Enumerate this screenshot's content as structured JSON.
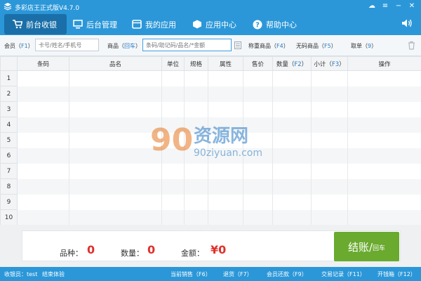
{
  "window": {
    "title": "多彩店王正式版V4.7.0",
    "controls": [
      "cloud-icon",
      "menu-icon",
      "minimize-icon",
      "close-icon"
    ]
  },
  "nav": {
    "tabs": [
      {
        "label": "前台收银",
        "icon": "cart-icon",
        "active": true
      },
      {
        "label": "后台管理",
        "icon": "monitor-icon",
        "active": false
      },
      {
        "label": "我的应用",
        "icon": "apps-icon",
        "active": false
      },
      {
        "label": "应用中心",
        "icon": "box-icon",
        "active": false
      },
      {
        "label": "帮助中心",
        "icon": "help-icon",
        "active": false
      }
    ],
    "right_icon": "volume-icon"
  },
  "search": {
    "member_label": "会员（",
    "member_key": "F1",
    "member_close": "）",
    "member_placeholder": "卡号/姓名/手机号",
    "goods_label": "商品（",
    "goods_key": "回车",
    "goods_close": "）",
    "goods_placeholder": "条码/助记码/品名/*金额",
    "weigh_label": "称重商品（",
    "weigh_key": "F4",
    "weigh_close": "）",
    "nocode_label": "无码商品（",
    "nocode_key": "F5",
    "nocode_close": "）",
    "pickup_label": "取单（",
    "pickup_key": "9",
    "pickup_close": "）"
  },
  "table": {
    "columns": [
      {
        "label": "",
        "key": ""
      },
      {
        "label": "条码",
        "key": ""
      },
      {
        "label": "品名",
        "key": ""
      },
      {
        "label": "单位",
        "key": ""
      },
      {
        "label": "规格",
        "key": ""
      },
      {
        "label": "属性",
        "key": ""
      },
      {
        "label": "售价",
        "key": ""
      },
      {
        "label": "数量（",
        "key": "F2",
        "close": "）"
      },
      {
        "label": "小计（",
        "key": "F3",
        "close": "）"
      },
      {
        "label": "操作",
        "key": ""
      }
    ],
    "row_numbers": [
      "1",
      "2",
      "3",
      "4",
      "5",
      "6",
      "7",
      "8",
      "9",
      "10"
    ]
  },
  "watermark": {
    "brand_num": "90",
    "brand_cn": "资源网",
    "brand_url": "90ziyuan.com"
  },
  "summary": {
    "variety_label": "品种：",
    "variety_value": "0",
    "qty_label": "数量：",
    "qty_value": "0",
    "amount_label": "金额：",
    "amount_value": "¥0",
    "checkout_main": "结账/",
    "checkout_sub": "回车"
  },
  "status": {
    "cashier": "收银员：test",
    "end_shift": "结束体验",
    "current_sales": "当前销售（F6）",
    "return": "退货（F7）",
    "member_repay": "会员还款（F9）",
    "records": "交易记录（F11）",
    "open_drawer": "开钱箱（F12）"
  },
  "colors": {
    "primary": "#2b97d8",
    "active_tab": "#1a6fa8",
    "checkout": "#6aaa2f",
    "value_red": "#e0312c"
  }
}
